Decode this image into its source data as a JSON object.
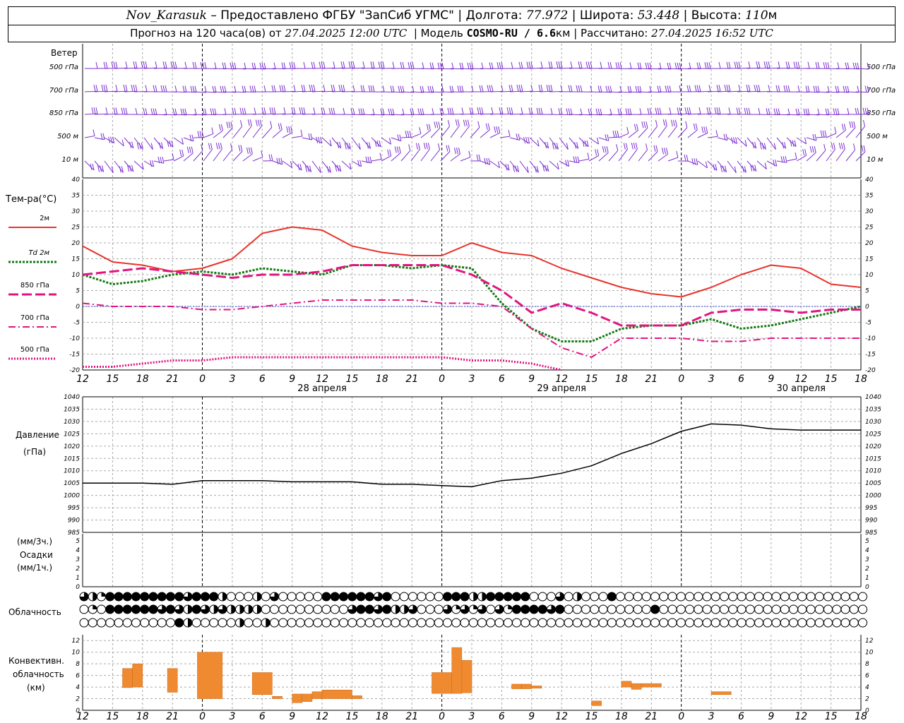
{
  "header": {
    "station": "Nov_Karasuk",
    "provider": "– Предоставлено ФГБУ \"ЗапСиб УГМС\"",
    "lon_label": "Долгота:",
    "lon": "77.972",
    "lat_label": "Широта:",
    "lat": "53.448",
    "alt_label": "Высота:",
    "alt": "110",
    "alt_unit": "м",
    "fc_label": "Прогноз на 120 часа(ов) от",
    "fc_time": "27.04.2025 12:00 UTC",
    "model_label": "Модель",
    "model": "COSMO-RU / 6.6",
    "model_unit": "км",
    "calc_label": "Рассчитано:",
    "calc_time": "27.04.2025 16:52 UTC"
  },
  "time_axis": {
    "hours": [
      "12",
      "15",
      "18",
      "21",
      "0",
      "3",
      "6",
      "9",
      "12",
      "15",
      "18",
      "21",
      "0",
      "3",
      "6",
      "9",
      "12",
      "15",
      "18",
      "21",
      "0",
      "3",
      "6",
      "9",
      "12",
      "15",
      "18"
    ],
    "dates": [
      "28 апреля",
      "29 апреля",
      "30 апреля"
    ]
  },
  "wind_panel": {
    "title": "Ветер",
    "levels": [
      "500 гПа",
      "700 гПа",
      "850 гПа",
      "500  м",
      "10  м"
    ]
  },
  "temp_panel": {
    "title": "Тем-ра(°C)",
    "legend": [
      {
        "label": "2м",
        "color": "#e8332a",
        "style": "solid"
      },
      {
        "label": "Td  2м",
        "color": "#117a11",
        "style": "dotted"
      },
      {
        "label": "850 гПа",
        "color": "#e0157f",
        "style": "longdash"
      },
      {
        "label": "700 гПа",
        "color": "#e0157f",
        "style": "dashdot"
      },
      {
        "label": "500 гПа",
        "color": "#e0157f",
        "style": "dense-dotted"
      }
    ],
    "y_ticks": [
      "40",
      "35",
      "30",
      "25",
      "20",
      "15",
      "10",
      "5",
      "0",
      "-5",
      "-10",
      "-15",
      "-20"
    ]
  },
  "pressure_panel": {
    "title": "Давление",
    "unit": "(гПа)",
    "y_ticks": [
      "1040",
      "1035",
      "1030",
      "1025",
      "1020",
      "1015",
      "1010",
      "1005",
      "1000",
      "995",
      "990",
      "985"
    ]
  },
  "precip_panel": {
    "unit3": "(мм/3ч.)",
    "title": "Осадки",
    "unit1": "(мм/1ч.)",
    "y_ticks": [
      "5",
      "4",
      "3",
      "2",
      "1",
      "0"
    ]
  },
  "cloud_panel": {
    "title": "Облачность"
  },
  "conv_panel": {
    "title1": "Конвективн.",
    "title2": "облачность",
    "unit": "(км)",
    "y_ticks": [
      "12",
      "10",
      "8",
      "6",
      "4",
      "2",
      "0"
    ]
  },
  "chart_data": {
    "type": "line",
    "x_hours_from_start": [
      0,
      3,
      6,
      9,
      12,
      15,
      18,
      21,
      24,
      27,
      30,
      33,
      36,
      39,
      42,
      45,
      48,
      51,
      54,
      57,
      60,
      63,
      66,
      69,
      72,
      75,
      78
    ],
    "series": [
      {
        "name": "2м",
        "color": "#e8332a",
        "values": [
          19,
          14,
          13,
          11,
          12,
          15,
          23,
          25,
          24,
          19,
          17,
          16,
          16,
          20,
          17,
          16,
          12,
          9,
          6,
          4,
          3,
          6,
          10,
          13,
          12,
          7,
          6
        ]
      },
      {
        "name": "Td  2м",
        "color": "#117a11",
        "values": [
          10,
          7,
          8,
          10,
          11,
          10,
          12,
          11,
          10,
          13,
          13,
          12,
          13,
          12,
          1,
          -7,
          -11,
          -11,
          -7,
          -6,
          -6,
          -4,
          -7,
          -6,
          -4,
          -2,
          0
        ]
      },
      {
        "name": "850 гПа",
        "color": "#e0157f",
        "values": [
          10,
          11,
          12,
          11,
          10,
          9,
          10,
          10,
          11,
          13,
          13,
          13,
          13,
          10,
          5,
          -2,
          1,
          -2,
          -6,
          -6,
          -6,
          -2,
          -1,
          -1,
          -2,
          -1,
          -1
        ]
      },
      {
        "name": "700 гПа",
        "color": "#e0157f",
        "values": [
          1,
          0,
          0,
          0,
          -1,
          -1,
          0,
          1,
          2,
          2,
          2,
          2,
          1,
          1,
          0,
          -7,
          -13,
          -16,
          -10,
          -10,
          -10,
          -11,
          -11,
          -10,
          -10,
          -10,
          -10
        ]
      },
      {
        "name": "500 гПа",
        "color": "#e0157f",
        "values": [
          -19,
          -19,
          -18,
          -17,
          -17,
          -16,
          -16,
          -16,
          -16,
          -16,
          -16,
          -16,
          -16,
          -17,
          -17,
          -18,
          -20
        ]
      }
    ],
    "pressure_hpa": [
      1005,
      1005,
      1005,
      1004.5,
      1006,
      1006,
      1006,
      1005.5,
      1005.5,
      1005.5,
      1004.5,
      1004.5,
      1004,
      1003.5,
      1006,
      1007,
      1009,
      1012,
      1017,
      1021,
      1026,
      1029,
      1028.5,
      1027,
      1026.5,
      1026.5,
      1026.5
    ],
    "cloud_cover_rows": [
      [
        3,
        2,
        1,
        4,
        4,
        4,
        4,
        4,
        4,
        4,
        4,
        4,
        3,
        4,
        4,
        4,
        2,
        0,
        0,
        0,
        2,
        0,
        3,
        0,
        0,
        0,
        0,
        0,
        4,
        4,
        4,
        4,
        4,
        4,
        3,
        4,
        0,
        0,
        0,
        0,
        0,
        0,
        4,
        4,
        4,
        2,
        2,
        4,
        4,
        4,
        4,
        4,
        0,
        0,
        0,
        3,
        0,
        2,
        0,
        0,
        0,
        4,
        0,
        0,
        0,
        0,
        0,
        0,
        0,
        0,
        0,
        0,
        0,
        0,
        0,
        0,
        0,
        0,
        0,
        0,
        0,
        0,
        0,
        0,
        0,
        0,
        0,
        0,
        0,
        0,
        0
      ],
      [
        0,
        1,
        0,
        4,
        4,
        4,
        4,
        4,
        4,
        3,
        4,
        3,
        2,
        4,
        3,
        2,
        3,
        2,
        2,
        2,
        2,
        0,
        0,
        0,
        0,
        0,
        0,
        0,
        0,
        0,
        0,
        3,
        4,
        4,
        3,
        4,
        2,
        2,
        3,
        0,
        0,
        0,
        3,
        1,
        3,
        1,
        3,
        0,
        3,
        1,
        4,
        4,
        4,
        4,
        3,
        4,
        0,
        0,
        0,
        0,
        0,
        0,
        0,
        0,
        0,
        0,
        4,
        0,
        0,
        0,
        0,
        0,
        0,
        0,
        0,
        0,
        0,
        0,
        0,
        0,
        0,
        0,
        0,
        0,
        0,
        0,
        0,
        0,
        0,
        0,
        0
      ],
      [
        0,
        0,
        0,
        0,
        0,
        0,
        0,
        0,
        0,
        0,
        0,
        4,
        2,
        0,
        0,
        0,
        0,
        0,
        2,
        0,
        0,
        2,
        0,
        0,
        0,
        0,
        0,
        0,
        0,
        0,
        0,
        0,
        0,
        0,
        0,
        0,
        0,
        0,
        0,
        0,
        0,
        0,
        0,
        0,
        0,
        0,
        0,
        0,
        0,
        0,
        0,
        0,
        0,
        0,
        0,
        0,
        0,
        0,
        0,
        0,
        0,
        0,
        0,
        0,
        0,
        0,
        0,
        0,
        0,
        0,
        0,
        0,
        0,
        0,
        0,
        0,
        0,
        0,
        0,
        0,
        0,
        0,
        0,
        0,
        0,
        0,
        0,
        0,
        0,
        0,
        0
      ]
    ],
    "convective_cloud_km": [
      {
        "h0": 4,
        "h1": 5,
        "base": 3.9,
        "top": 7.2
      },
      {
        "h0": 5,
        "h1": 6,
        "base": 4.0,
        "top": 8.0
      },
      {
        "h0": 8.5,
        "h1": 9.5,
        "base": 3.1,
        "top": 7.2
      },
      {
        "h0": 11.5,
        "h1": 14,
        "base": 2.0,
        "top": 10.0
      },
      {
        "h0": 17,
        "h1": 19,
        "base": 2.7,
        "top": 6.5
      },
      {
        "h0": 19,
        "h1": 20,
        "base": 2.0,
        "top": 2.4
      },
      {
        "h0": 21,
        "h1": 22,
        "base": 1.3,
        "top": 2.8
      },
      {
        "h0": 22,
        "h1": 23,
        "base": 1.5,
        "top": 2.8
      },
      {
        "h0": 23,
        "h1": 24,
        "base": 2.0,
        "top": 3.2
      },
      {
        "h0": 24,
        "h1": 27,
        "base": 2.0,
        "top": 3.5
      },
      {
        "h0": 27,
        "h1": 28,
        "base": 2.0,
        "top": 2.5
      },
      {
        "h0": 35,
        "h1": 37,
        "base": 2.9,
        "top": 6.5
      },
      {
        "h0": 37,
        "h1": 38,
        "base": 2.9,
        "top": 10.8
      },
      {
        "h0": 38,
        "h1": 39,
        "base": 3.0,
        "top": 8.6
      },
      {
        "h0": 43,
        "h1": 44,
        "base": 3.7,
        "top": 4.5
      },
      {
        "h0": 44,
        "h1": 45,
        "base": 3.7,
        "top": 4.5
      },
      {
        "h0": 45,
        "h1": 46,
        "base": 3.8,
        "top": 4.2
      },
      {
        "h0": 51,
        "h1": 52,
        "base": 0.8,
        "top": 1.6
      },
      {
        "h0": 54,
        "h1": 55,
        "base": 4.0,
        "top": 5.0
      },
      {
        "h0": 55,
        "h1": 56,
        "base": 3.6,
        "top": 4.6
      },
      {
        "h0": 56,
        "h1": 58,
        "base": 4.0,
        "top": 4.6
      },
      {
        "h0": 63,
        "h1": 65,
        "base": 2.7,
        "top": 3.2
      }
    ]
  }
}
